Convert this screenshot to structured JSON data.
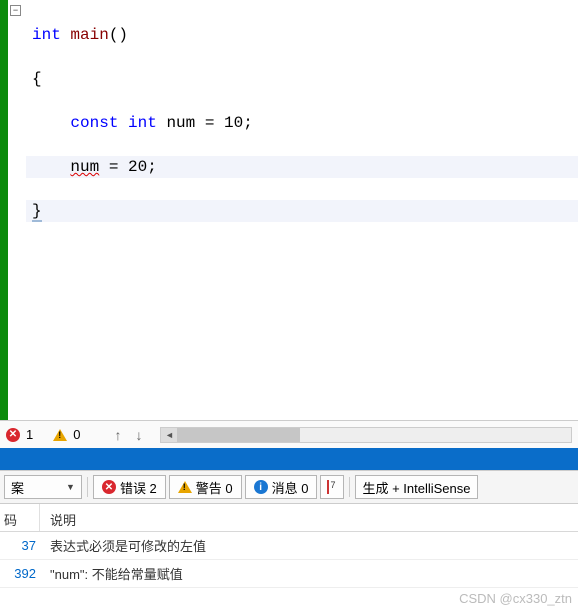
{
  "code": {
    "line1_kw": "int",
    "line1_func": " main",
    "line1_rest": "()",
    "line2": "{",
    "line3_indent": "    ",
    "line3_kw1": "const",
    "line3_sp1": " ",
    "line3_kw2": "int",
    "line3_rest": " num = 10;",
    "line4_indent": "    ",
    "line4_var": "num",
    "line4_rest": " = 20;",
    "line5": "}"
  },
  "fold_symbol": "−",
  "status": {
    "error_count": "1",
    "warn_count": "0"
  },
  "toolbar": {
    "left_label": "案",
    "errors_label": "错误 2",
    "warnings_label": "警告 0",
    "messages_label": "消息 0",
    "build_label": "生成 + IntelliSense"
  },
  "table": {
    "head_code": "码",
    "head_desc": "说明",
    "rows": [
      {
        "code": "37",
        "desc": "表达式必须是可修改的左值"
      },
      {
        "code": "392",
        "desc": "\"num\": 不能给常量赋值"
      }
    ]
  },
  "watermark": "CSDN @cx330_ztn"
}
